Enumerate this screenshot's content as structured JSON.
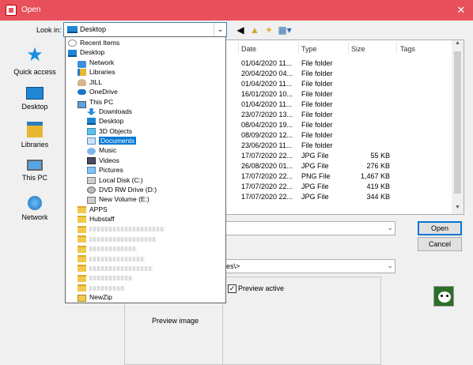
{
  "window": {
    "title": "Open",
    "close_glyph": "✕"
  },
  "toolbar": {
    "look_in_label": "Look in:",
    "look_in_value": "Desktop",
    "buttons": [
      "back-icon",
      "up-folder-icon",
      "new-folder-icon",
      "view-menu-icon"
    ]
  },
  "places": [
    {
      "label": "Quick access",
      "icon": "star-icon"
    },
    {
      "label": "Desktop",
      "icon": "desktop-icon"
    },
    {
      "label": "Libraries",
      "icon": "libraries-icon"
    },
    {
      "label": "This PC",
      "icon": "pc-icon"
    },
    {
      "label": "Network",
      "icon": "network-icon"
    }
  ],
  "file_list": {
    "columns": [
      "Date",
      "Type",
      "Size",
      "Tags"
    ],
    "rows": [
      {
        "date": "01/04/2020 11...",
        "type": "File folder",
        "size": ""
      },
      {
        "date": "20/04/2020 04...",
        "type": "File folder",
        "size": ""
      },
      {
        "date": "01/04/2020 11...",
        "type": "File folder",
        "size": ""
      },
      {
        "date": "16/01/2020 10...",
        "type": "File folder",
        "size": ""
      },
      {
        "date": "01/04/2020 11...",
        "type": "File folder",
        "size": ""
      },
      {
        "date": "23/07/2020 13...",
        "type": "File folder",
        "size": ""
      },
      {
        "date": "08/04/2020 19...",
        "type": "File folder",
        "size": ""
      },
      {
        "date": "08/09/2020 12...",
        "type": "File folder",
        "size": ""
      },
      {
        "date": "23/06/2020 11...",
        "type": "File folder",
        "size": ""
      },
      {
        "date": "17/07/2020 22...",
        "type": "JPG File",
        "size": "55 KB"
      },
      {
        "date": "26/08/2020 01...",
        "type": "JPG File",
        "size": "276 KB"
      },
      {
        "date": "17/07/2020 22...",
        "type": "PNG File",
        "size": "1,467 KB"
      },
      {
        "date": "17/07/2020 22...",
        "type": "JPG File",
        "size": "419 KB"
      },
      {
        "date": "17/07/2020 22...",
        "type": "JPG File",
        "size": "344 KB"
      }
    ]
  },
  "dropdown_items": [
    {
      "label": "Recent Items",
      "icon": "recent"
    },
    {
      "label": "Desktop",
      "icon": "desktop"
    },
    {
      "label": "Network",
      "icon": "net"
    },
    {
      "label": "Libraries",
      "icon": "lib"
    },
    {
      "label": "JILL",
      "icon": "user"
    },
    {
      "label": "OneDrive",
      "icon": "cloud"
    },
    {
      "label": "This PC",
      "icon": "pc"
    },
    {
      "label": "Downloads",
      "icon": "down"
    },
    {
      "label": "Desktop",
      "icon": "desktop"
    },
    {
      "label": "3D Objects",
      "icon": "cube"
    },
    {
      "label": "Documents",
      "icon": "doc",
      "selected": true
    },
    {
      "label": "Music",
      "icon": "music"
    },
    {
      "label": "Videos",
      "icon": "video"
    },
    {
      "label": "Pictures",
      "icon": "pics"
    },
    {
      "label": "Local Disk (C:)",
      "icon": "disk"
    },
    {
      "label": "DVD RW Drive (D:)",
      "icon": "dvd"
    },
    {
      "label": "New Volume (E:)",
      "icon": "disk"
    },
    {
      "label": "APPS",
      "icon": "folder"
    },
    {
      "label": "Hubstaff",
      "icon": "folder"
    },
    {
      "label": "",
      "icon": "folder"
    },
    {
      "label": "",
      "icon": "folder"
    },
    {
      "label": "",
      "icon": "folder"
    },
    {
      "label": "",
      "icon": "folder"
    },
    {
      "label": "",
      "icon": "folder"
    },
    {
      "label": "",
      "icon": "folder"
    },
    {
      "label": "",
      "icon": "folder"
    },
    {
      "label": "NewZip",
      "icon": "zip"
    }
  ],
  "filetype_text": "es\\>",
  "buttons": {
    "open": "Open",
    "cancel": "Cancel"
  },
  "preview": {
    "checkbox_label": "Preview active",
    "checked": true,
    "image_label": "Preview image"
  }
}
